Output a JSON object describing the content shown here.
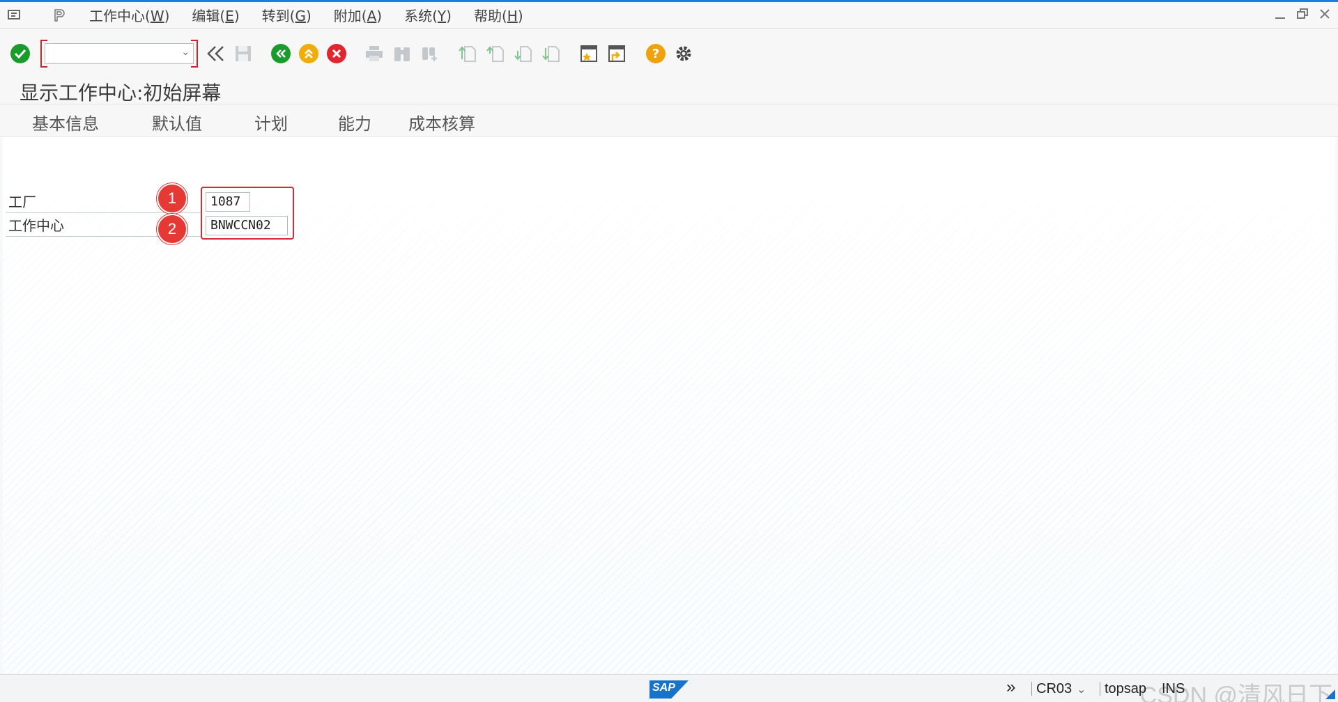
{
  "menubar": {
    "items": [
      {
        "label": "工作中心(",
        "key": "W",
        "end": ")"
      },
      {
        "label": "编辑(",
        "key": "E",
        "end": ")"
      },
      {
        "label": "转到(",
        "key": "G",
        "end": ")"
      },
      {
        "label": "附加(",
        "key": "A",
        "end": ")"
      },
      {
        "label": "系统(",
        "key": "Y",
        "end": ")"
      },
      {
        "label": "帮助(",
        "key": "H",
        "end": ")"
      }
    ]
  },
  "toolbar": {
    "command_value": "",
    "icons": [
      "enter-icon",
      "back-icon",
      "save-icon",
      "exit-icon",
      "up-icon",
      "cancel-icon",
      "print-icon",
      "find-icon",
      "find-next-icon",
      "first-page-icon",
      "prev-page-icon",
      "next-page-icon",
      "last-page-icon",
      "new-session-icon",
      "shortcut-icon",
      "help-icon",
      "settings-icon"
    ],
    "colors": {
      "green": "#1a9c2c",
      "amber": "#f0ac08",
      "red": "#e0262e"
    }
  },
  "page": {
    "title": "显示工作中心:初始屏幕"
  },
  "app_toolbar": {
    "buttons": [
      "基本信息",
      "默认值",
      "计划",
      "能力",
      "成本核算"
    ]
  },
  "form": {
    "plant_label": "工厂",
    "plant_value": "1087",
    "workcenter_label": "工作中心",
    "workcenter_value": "BNWCCN02",
    "badges": [
      "1",
      "2"
    ],
    "highlight_color": "#e0262e"
  },
  "statusbar": {
    "logo": "SAP",
    "transaction": "CR03",
    "server": "topsap",
    "mode": "INS",
    "watermark": "CSDN @清风日下"
  }
}
